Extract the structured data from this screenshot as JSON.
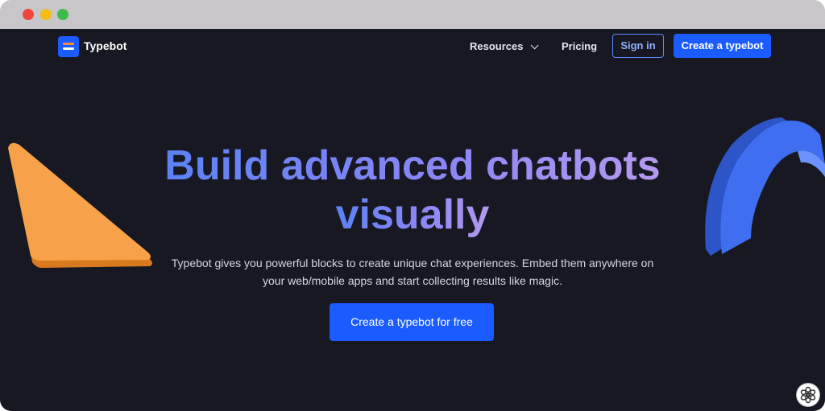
{
  "nav": {
    "brand": "Typebot",
    "resources_label": "Resources",
    "pricing_label": "Pricing",
    "signin_label": "Sign in",
    "create_label": "Create a typebot"
  },
  "hero": {
    "title_line1": "Build advanced chatbots",
    "title_line2": "visually",
    "subtitle": "Typebot gives you powerful blocks to create unique chat experiences. Embed them anywhere on your web/mobile apps and start collecting results like magic.",
    "cta_label": "Create a typebot for free"
  },
  "colors": {
    "background": "#171821",
    "accent": "#1a5cff",
    "orange_shape": "#f7a24a",
    "blue_shape": "#3f6ff0"
  },
  "icons": {
    "logo": "typebot-logo-icon",
    "chevron": "chevron-down-icon",
    "widget": "chat-assistant-icon"
  }
}
